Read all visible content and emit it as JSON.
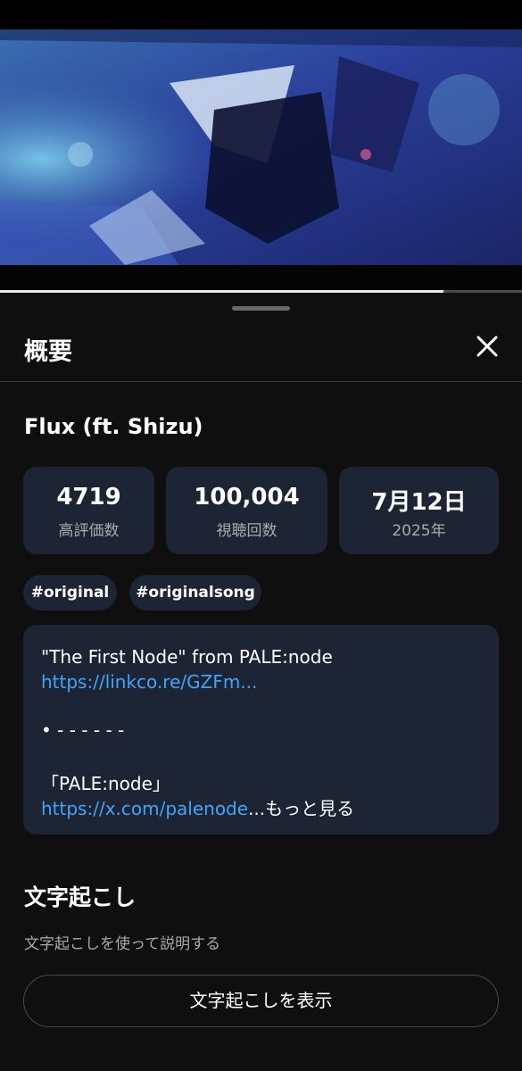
{
  "sheet": {
    "title": "概要"
  },
  "video": {
    "title": "Flux (ft. Shizu)",
    "progress_percent": 85
  },
  "stats": [
    {
      "value": "4719",
      "label": "高評価数"
    },
    {
      "value": "100,004",
      "label": "視聴回数"
    },
    {
      "value": "7月12日",
      "label": "2025年"
    }
  ],
  "tags": [
    "#original",
    "#originalsong"
  ],
  "description": {
    "line1": "\"The First Node\" from PALE:node",
    "link1": "https://linkco.re/GZFm...",
    "line3": "• - - - - - -",
    "line4": "「PALE:node」",
    "link2": "https://x.com/palenode",
    "more": "...もっと見る"
  },
  "transcript": {
    "title": "文字起こし",
    "subtitle": "文字起こしを使って説明する",
    "button": "文字起こしを表示"
  },
  "colors": {
    "card": "#1d2433",
    "link": "#3ea6ff",
    "background": "#0f0f0f"
  },
  "icons": {
    "close": "close-icon"
  }
}
